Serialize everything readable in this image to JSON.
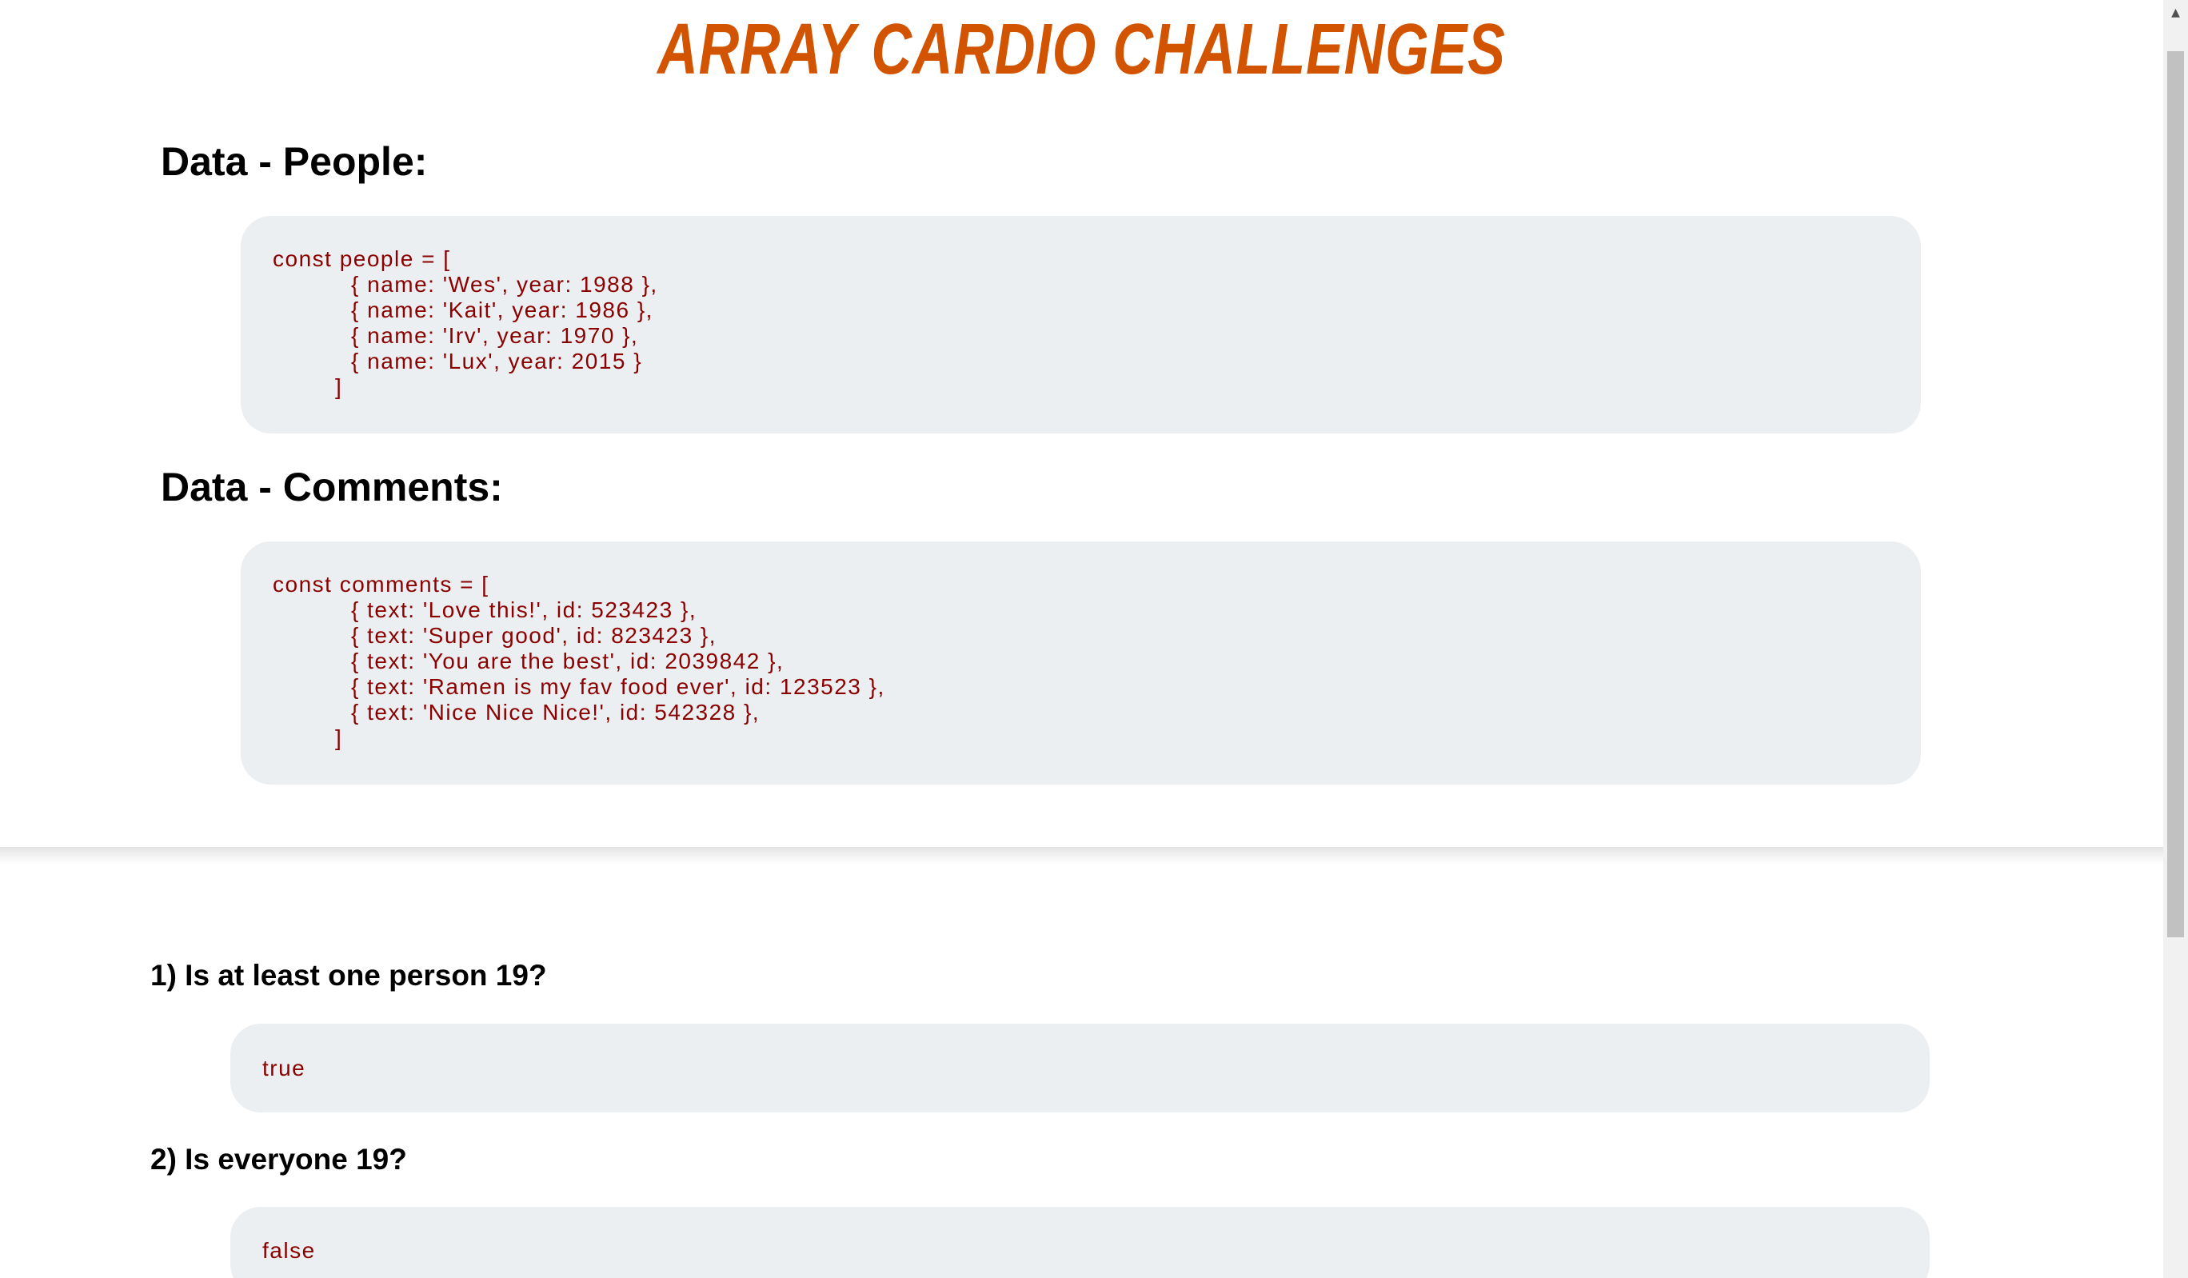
{
  "page": {
    "title": "ARRAY CARDIO CHALLENGES"
  },
  "people_section": {
    "heading": "Data - People:",
    "code_lines": [
      "const people = [",
      "{ name: 'Wes', year: 1988 },",
      "{ name: 'Kait', year: 1986 },",
      "{ name: 'Irv', year: 1970 },",
      "{ name: 'Lux', year: 2015 }",
      "]"
    ]
  },
  "comments_section": {
    "heading": "Data - Comments:",
    "code_lines": [
      "const comments = [",
      "{ text: 'Love this!', id: 523423 },",
      "{ text: 'Super good', id: 823423 },",
      "{ text: 'You are the best', id: 2039842 },",
      "{ text: 'Ramen is my fav food ever', id: 123523 },",
      "{ text: 'Nice Nice Nice!', id: 542328 },",
      "]"
    ]
  },
  "questions": [
    {
      "label": "1) Is at least one person 19?",
      "answer": "true"
    },
    {
      "label": "2) Is everyone 19?",
      "answer": "false"
    }
  ],
  "colors": {
    "title": "#d35400",
    "code_text": "#8b0000",
    "code_background": "#eceff1"
  },
  "icons": {
    "scroll_up": "triangle-up-icon"
  }
}
